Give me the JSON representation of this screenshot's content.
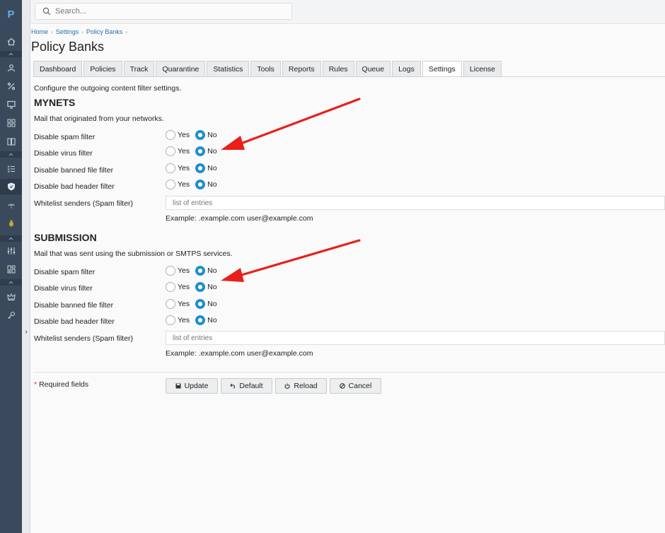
{
  "app": {
    "logo_letter": "P"
  },
  "search": {
    "placeholder": "Search..."
  },
  "breadcrumb": [
    "Home",
    "Settings",
    "Policy Banks"
  ],
  "page_title": "Policy Banks",
  "tabs": [
    "Dashboard",
    "Policies",
    "Track",
    "Quarantine",
    "Statistics",
    "Tools",
    "Reports",
    "Rules",
    "Queue",
    "Logs",
    "Settings",
    "License"
  ],
  "active_tab": "Settings",
  "intro": "Configure the outgoing content filter settings.",
  "sections": [
    {
      "title": "MYNETS",
      "description": "Mail that originated from your networks.",
      "fields": [
        {
          "label": "Disable spam filter",
          "yes": "Yes",
          "no": "No",
          "value": "No"
        },
        {
          "label": "Disable virus filter",
          "yes": "Yes",
          "no": "No",
          "value": "No"
        },
        {
          "label": "Disable banned file filter",
          "yes": "Yes",
          "no": "No",
          "value": "No"
        },
        {
          "label": "Disable bad header filter",
          "yes": "Yes",
          "no": "No",
          "value": "No"
        }
      ],
      "whitelist_label": "Whitelist senders (Spam filter)",
      "whitelist_placeholder": "list of entries",
      "example": "Example: .example.com user@example.com"
    },
    {
      "title": "SUBMISSION",
      "description": "Mail that was sent using the submission or SMTPS services.",
      "fields": [
        {
          "label": "Disable spam filter",
          "yes": "Yes",
          "no": "No",
          "value": "No"
        },
        {
          "label": "Disable virus filter",
          "yes": "Yes",
          "no": "No",
          "value": "No"
        },
        {
          "label": "Disable banned file filter",
          "yes": "Yes",
          "no": "No",
          "value": "No"
        },
        {
          "label": "Disable bad header filter",
          "yes": "Yes",
          "no": "No",
          "value": "No"
        }
      ],
      "whitelist_label": "Whitelist senders (Spam filter)",
      "whitelist_placeholder": "list of entries",
      "example": "Example: .example.com user@example.com"
    }
  ],
  "required_fields": "Required fields",
  "required_star": "*",
  "buttons": {
    "update": "Update",
    "default": "Default",
    "reload": "Reload",
    "cancel": "Cancel"
  },
  "colors": {
    "sidebar": "#3a4a5c",
    "accent": "#1e8fd0",
    "arrow": "#e8201a",
    "link": "#2a6fb0"
  }
}
